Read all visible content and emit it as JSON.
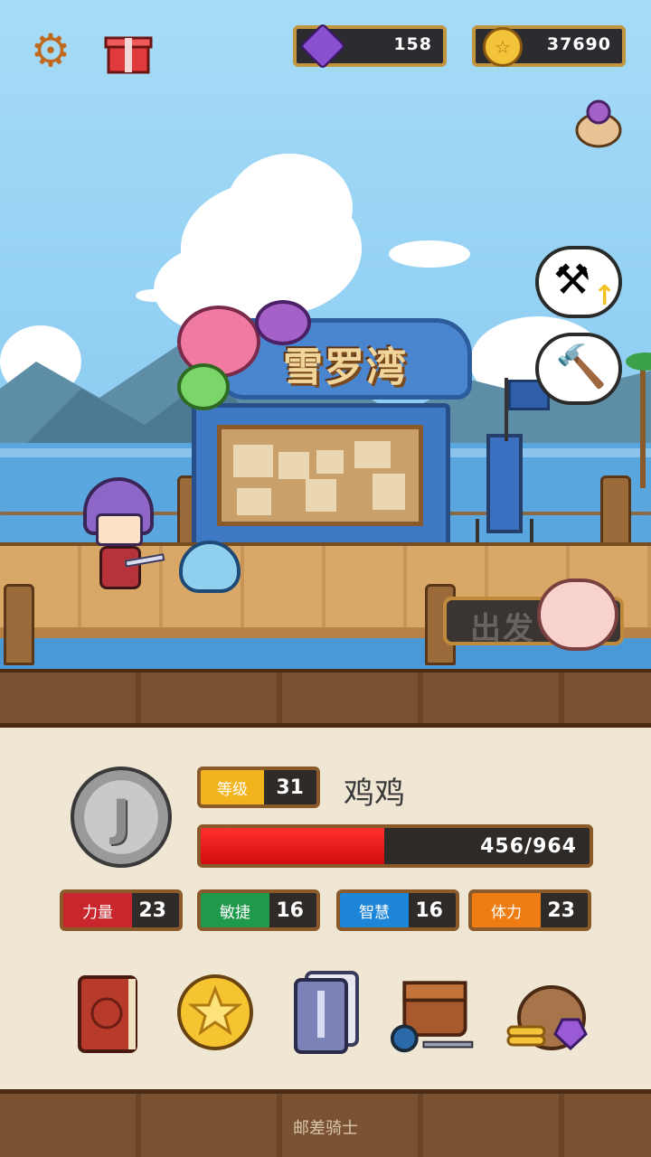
{
  "hud": {
    "gems": "158",
    "coins": "37690",
    "coin_glyph": "☆"
  },
  "scene": {
    "location_name": "雪罗湾",
    "depart_label": "出发"
  },
  "player": {
    "medal_letter": "J",
    "level_label": "等级",
    "level": "31",
    "name": "鸡鸡",
    "hp_text": "456/964",
    "hp_current": 456,
    "hp_max": 964,
    "stats": [
      {
        "label": "力量",
        "value": "23",
        "color": "#c8262c"
      },
      {
        "label": "敏捷",
        "value": "16",
        "color": "#1e9a4a"
      },
      {
        "label": "智慧",
        "value": "16",
        "color": "#1e86d8"
      },
      {
        "label": "体力",
        "value": "23",
        "color": "#f07c14"
      }
    ]
  },
  "menu": {
    "items": [
      {
        "icon": "book-icon"
      },
      {
        "icon": "star-coin-icon"
      },
      {
        "icon": "card-deck-icon"
      },
      {
        "icon": "inventory-bag-icon"
      },
      {
        "icon": "treasure-sack-icon"
      }
    ]
  },
  "footer": {
    "game_title": "邮差骑士"
  }
}
